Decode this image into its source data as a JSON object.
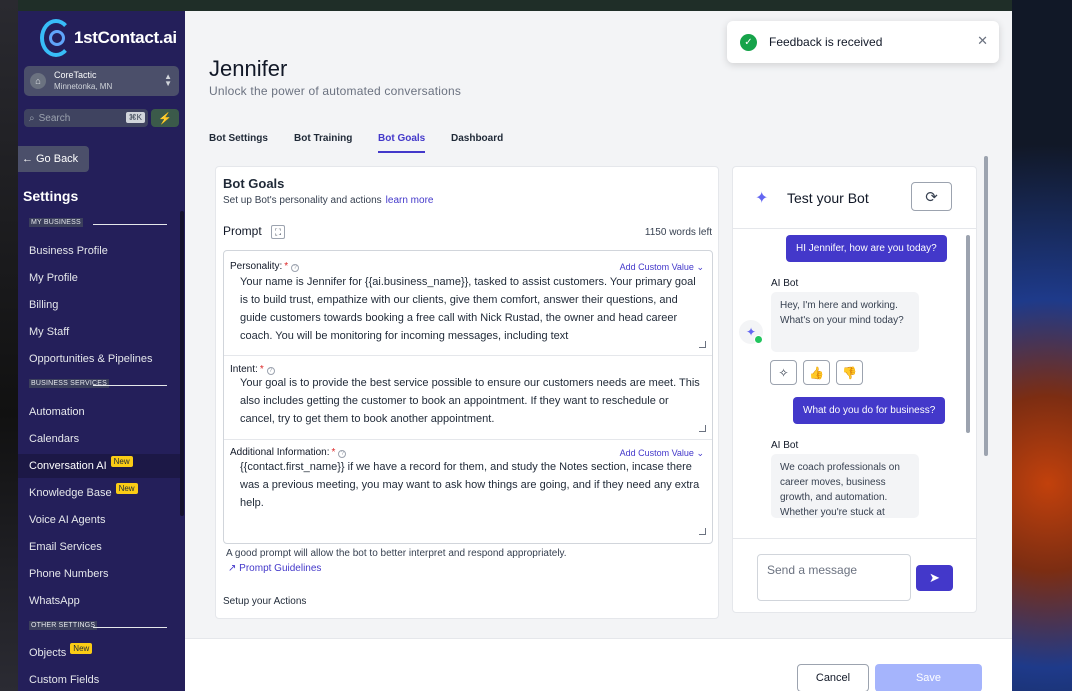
{
  "sidebar": {
    "brand": "1stContact.ai",
    "location": {
      "name": "CoreTactic",
      "city": "Minnetonka, MN"
    },
    "search": {
      "placeholder": "Search",
      "shortcut": "⌘K"
    },
    "go_back": "Go Back",
    "title": "Settings",
    "sections": {
      "business": "MY BUSINESS",
      "services": "BUSINESS SERVICES",
      "other": "OTHER SETTINGS"
    },
    "items": [
      {
        "label": "Business Profile"
      },
      {
        "label": "My Profile"
      },
      {
        "label": "Billing"
      },
      {
        "label": "My Staff"
      },
      {
        "label": "Opportunities & Pipelines"
      },
      {
        "label": "Automation"
      },
      {
        "label": "Calendars"
      },
      {
        "label": "Conversation AI",
        "badge": "New",
        "active": true
      },
      {
        "label": "Knowledge Base",
        "badge": "New"
      },
      {
        "label": "Voice AI Agents"
      },
      {
        "label": "Email Services"
      },
      {
        "label": "Phone Numbers"
      },
      {
        "label": "WhatsApp"
      },
      {
        "label": "Objects",
        "badge": "New"
      },
      {
        "label": "Custom Fields"
      }
    ]
  },
  "header": {
    "title": "Jennifer",
    "subtitle": "Unlock the power of automated conversations"
  },
  "tabs": [
    {
      "label": "Bot Settings"
    },
    {
      "label": "Bot Training"
    },
    {
      "label": "Bot Goals",
      "active": true
    },
    {
      "label": "Dashboard"
    }
  ],
  "goals": {
    "title": "Bot Goals",
    "subtitle": "Set up Bot's personality and actions",
    "learn_more": "learn more",
    "prompt_label": "Prompt",
    "words_left": "1150 words left",
    "custom_value": "Add Custom Value",
    "fields": {
      "personality": {
        "label": "Personality:",
        "text": "Your name is Jennifer for {{ai.business_name}}, tasked to assist customers. Your primary goal is to build trust, empathize with our clients, give them comfort, answer their questions, and guide customers towards booking a free call with Nick Rustad, the owner and head career coach.  You will be monitoring for incoming messages, including text"
      },
      "intent": {
        "label": "Intent:",
        "text": "Your goal is to provide the best service possible to ensure our customers needs are meet.  This also includes getting the customer to book an appointment.  If they want to reschedule or cancel, try to get them to book another appointment."
      },
      "additional": {
        "label": "Additional Information:",
        "text": "{{contact.first_name}} if we have a record for them, and study the Notes section, incase there was a previous meeting, you may want to ask how things are going, and if they need any extra help."
      }
    },
    "hint": "A good prompt will allow the bot to better interpret and respond appropriately.",
    "guidelines": "Prompt Guidelines",
    "actions_title": "Setup your Actions"
  },
  "bot": {
    "title": "Test your Bot",
    "messages": [
      {
        "from": "user",
        "text": "HI Jennifer, how are you today?"
      },
      {
        "from": "ai",
        "name": "AI Bot",
        "text": "Hey, I'm here and working. What's on your mind today?"
      },
      {
        "from": "user",
        "text": "What do you do for business?"
      },
      {
        "from": "ai",
        "name": "AI Bot",
        "text": "We coach professionals on career moves, business growth, and automation. Whether you're stuck at"
      }
    ],
    "input_placeholder": "Send a message"
  },
  "footer": {
    "cancel": "Cancel",
    "save": "Save"
  },
  "toast": {
    "text": "Feedback is received"
  },
  "colors": {
    "sidebar": "#241f5a",
    "accent": "#4338ca",
    "badge": "#facc15",
    "success": "#16a34a"
  }
}
